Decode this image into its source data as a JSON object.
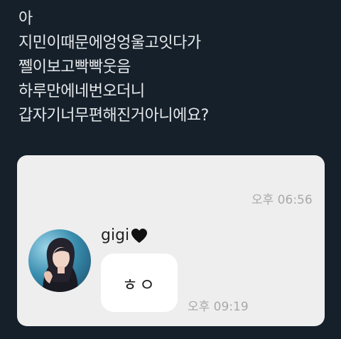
{
  "tweet": {
    "lines": [
      "아",
      "지민이때문에엉엉울고잇다가",
      "쩰이보고빡빡웃음",
      "하루만에네번오더니",
      "갑자기너무편해진거아니에요?"
    ]
  },
  "chat": {
    "time_top": "오후 06:56",
    "sender": "gigi",
    "sender_emoji_icon": "black-heart-icon",
    "message": "ㅎㅇ",
    "time_bottom": "오후 09:19",
    "colors": {
      "background": "#eeeeee",
      "bubble": "#ffffff",
      "timestamp": "#a9a9a9"
    }
  },
  "colors": {
    "page_background": "#15202b",
    "text": "#e7e9ea"
  }
}
